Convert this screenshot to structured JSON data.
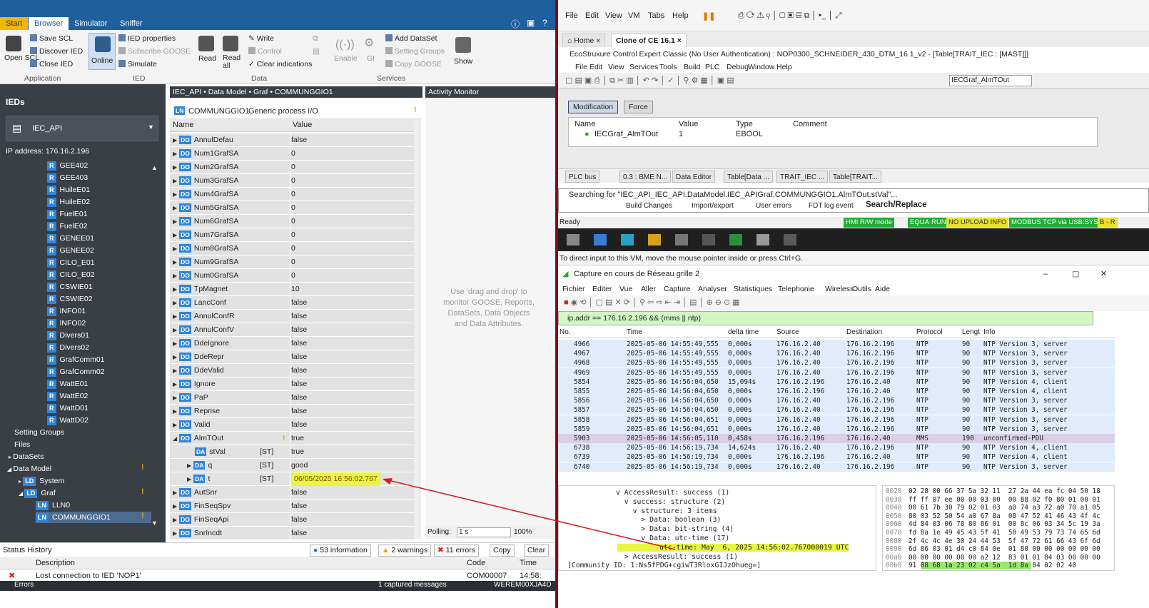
{
  "left_app": {
    "tabs": [
      "Start",
      "Browser",
      "Simulator",
      "Sniffer"
    ],
    "ribbon": {
      "open_scl": "Open SCL",
      "save_scl": "Save SCL",
      "discover_ied": "Discover IED",
      "close_ied": "Close IED",
      "online": "Online",
      "ied_properties": "IED properties",
      "subscribe_goose": "Subscribe GOOSE",
      "simulate": "Simulate",
      "read": "Read",
      "read_all": "Read all",
      "write": "Write",
      "control": "Control",
      "clear_indications": "Clear indications",
      "enable": "Enable",
      "gi": "GI",
      "add_dataset": "Add DataSet",
      "setting_groups": "Setting Groups",
      "copy_goose": "Copy GOOSE",
      "show": "Show",
      "groups": [
        "Application",
        "IED",
        "Data",
        "Services"
      ]
    },
    "sidebar": {
      "title": "IEDs",
      "ied_name": "IEC_API",
      "ip": "IP address: 176.16.2.196",
      "r_items": [
        "GEE402",
        "GEE403",
        "HuileE01",
        "HuileE02",
        "FuelE01",
        "FuelE02",
        "GENEE01",
        "GENEE02",
        "CILO_E01",
        "CILO_E02",
        "CSWIE01",
        "CSWIE02",
        "INFO01",
        "INFO02",
        "Divers01",
        "Divers02",
        "GrafComm01",
        "GrafComm02",
        "WattE01",
        "WattE02",
        "WattD01",
        "WattD02"
      ],
      "setting_groups": "Setting Groups",
      "files": "Files",
      "datasets": "DataSets",
      "data_model": "Data Model",
      "system": "System",
      "graf": "Graf",
      "lln0": "LLN0",
      "commun": "COMMUNGGIO1"
    },
    "center": {
      "breadcrumb": "IEC_API • Data Model • Graf • COMMUNGGIO1",
      "ln_name": "COMMUNGGIO1",
      "ln_desc": "Generic process I/O",
      "col_name": "Name",
      "col_value": "Value",
      "rows": [
        {
          "n": "AnnulDefau",
          "v": "false"
        },
        {
          "n": "Num1GrafSA",
          "v": "0"
        },
        {
          "n": "Num2GrafSA",
          "v": "0"
        },
        {
          "n": "Num3GrafSA",
          "v": "0"
        },
        {
          "n": "Num4GrafSA",
          "v": "0"
        },
        {
          "n": "Num5GrafSA",
          "v": "0"
        },
        {
          "n": "Num6GrafSA",
          "v": "0"
        },
        {
          "n": "Num7GrafSA",
          "v": "0"
        },
        {
          "n": "Num8GrafSA",
          "v": "0"
        },
        {
          "n": "Num9GrafSA",
          "v": "0"
        },
        {
          "n": "Num0GrafSA",
          "v": "0"
        },
        {
          "n": "TpMagnet",
          "v": "10"
        },
        {
          "n": "LancConf",
          "v": "false"
        },
        {
          "n": "AnnulConfR",
          "v": "false"
        },
        {
          "n": "AnnulConfV",
          "v": "false"
        },
        {
          "n": "DdeIgnore",
          "v": "false"
        },
        {
          "n": "DdeRepr",
          "v": "false"
        },
        {
          "n": "DdeValid",
          "v": "false"
        },
        {
          "n": "Ignore",
          "v": "false"
        },
        {
          "n": "PaP",
          "v": "false"
        },
        {
          "n": "Reprise",
          "v": "false"
        },
        {
          "n": "Valid",
          "v": "false"
        },
        {
          "n": "AlmTOut",
          "v": "true"
        },
        {
          "n": "stVal",
          "v": "true",
          "fc": "[ST]"
        },
        {
          "n": "q",
          "v": "good",
          "fc": "[ST]"
        },
        {
          "n": "t",
          "v": "06/05/2025 16:56:02.767",
          "fc": "[ST]"
        },
        {
          "n": "AutSnr",
          "v": "false"
        },
        {
          "n": "FinSeqSpv",
          "v": "false"
        },
        {
          "n": "FinSeqApi",
          "v": "false"
        },
        {
          "n": "SnrIncdt",
          "v": "false"
        }
      ]
    },
    "activity": {
      "title": "Activity Monitor",
      "hint": "Use 'drag and drop' to monitor GOOSE, Reports, DataSets, Data Objects and Data Attributes.",
      "polling_label": "Polling:",
      "polling_value": "1 s",
      "zoom": "100%"
    },
    "status": {
      "title": "Status History",
      "info": "53 information",
      "warnings": "2 warnings",
      "errors": "11 errors",
      "copy": "Copy",
      "clear": "Clear",
      "col_desc": "Description",
      "col_code": "Code",
      "col_time": "Time",
      "row_desc": "Lost connection to IED 'NOP1'",
      "row_code": "COM00007",
      "row_time": "14:58:",
      "foot_errors": "Errors",
      "foot_captured": "1 captured messages",
      "foot_host": "WEREM00XJA4D"
    }
  },
  "vm": {
    "menu": [
      "File",
      "Edit",
      "View",
      "VM",
      "Tabs",
      "Help"
    ],
    "tab_home": "Home",
    "tab_clone": "Clone of CE 16.1",
    "eco_title": "EcoStruxure Control Expert Classic (No User Authentication) : NOP0300_SCHNEIDER_430_DTM_16.1_v2 - [Table[TRAIT_IEC : [MAST]]]",
    "eco_menu": [
      "File",
      "Edit",
      "View",
      "Services",
      "Tools",
      "Build",
      "PLC",
      "Debug",
      "Window",
      "Help"
    ],
    "eco_combo": "IECGraf_AlmTOut",
    "mod_tabs": [
      "Modification",
      "Force"
    ],
    "grid_cols": [
      "Name",
      "Value",
      "Type",
      "Comment"
    ],
    "grid_row": {
      "name": "IECGraf_AlmTOut",
      "value": "1",
      "type": "EBOOL"
    },
    "eco_tabs": [
      "PLC bus",
      "0.3 : BME N...",
      "Data Editor",
      "Table[Data ...",
      "TRAIT_IEC ...",
      "Table[TRAIT..."
    ],
    "search_text": "Searching for \"IEC_API_IEC_API.DataModel.IEC_APIGraf.COMMUNGGIO1.AlmTOut.stVal\"...",
    "search_tabs": [
      "Build Changes",
      "Import/export",
      "User errors",
      "FDT log event",
      "Search/Replace"
    ],
    "ready": "Ready",
    "status_items": [
      {
        "t": "HMI R/W mode",
        "c": "#1fae3a"
      },
      {
        "t": "EQUAL",
        "c": "#1fae3a"
      },
      {
        "t": "RUN",
        "c": "#1fae3a"
      },
      {
        "t": "NO UPLOAD INFO",
        "c": "#e8e02a"
      },
      {
        "t": "MODBUS TCP via USB:SYS",
        "c": "#1fae3a"
      },
      {
        "t": "B - R",
        "c": "#e8e02a"
      }
    ],
    "hint": "To direct input to this VM, move the mouse pointer inside or press Ctrl+G."
  },
  "wireshark": {
    "title": "Capture en cours de Réseau grille 2",
    "menu": [
      "Fichier",
      "Editer",
      "Vue",
      "Aller",
      "Capture",
      "Analyser",
      "Statistiques",
      "Telephonie",
      "Wireless",
      "Outils",
      "Aide"
    ],
    "filter": "ip.addr == 176.16.2.196 && (mms || ntp)",
    "cols": [
      "No.",
      "Time",
      "delta time",
      "Source",
      "Destination",
      "Protocol",
      "Lengt",
      "Info"
    ],
    "packets": [
      [
        "4966",
        "2025-05-06 14:55:49,555",
        "0,000s",
        "176.16.2.40",
        "176.16.2.196",
        "NTP",
        "90",
        "NTP Version 3, server"
      ],
      [
        "4967",
        "2025-05-06 14:55:49,555",
        "0,000s",
        "176.16.2.40",
        "176.16.2.196",
        "NTP",
        "90",
        "NTP Version 3, server"
      ],
      [
        "4968",
        "2025-05-06 14:55:49,555",
        "0,000s",
        "176.16.2.40",
        "176.16.2.196",
        "NTP",
        "90",
        "NTP Version 3, server"
      ],
      [
        "4969",
        "2025-05-06 14:55:49,555",
        "0,000s",
        "176.16.2.40",
        "176.16.2.196",
        "NTP",
        "90",
        "NTP Version 3, server"
      ],
      [
        "5854",
        "2025-05-06 14:56:04,650",
        "15,094s",
        "176.16.2.196",
        "176.16.2.40",
        "NTP",
        "90",
        "NTP Version 4, client"
      ],
      [
        "5855",
        "2025-05-06 14:56:04,650",
        "0,000s",
        "176.16.2.196",
        "176.16.2.40",
        "NTP",
        "90",
        "NTP Version 4, client"
      ],
      [
        "5856",
        "2025-05-06 14:56:04,650",
        "0,000s",
        "176.16.2.40",
        "176.16.2.196",
        "NTP",
        "90",
        "NTP Version 3, server"
      ],
      [
        "5857",
        "2025-05-06 14:56:04,650",
        "0,000s",
        "176.16.2.40",
        "176.16.2.196",
        "NTP",
        "90",
        "NTP Version 3, server"
      ],
      [
        "5858",
        "2025-05-06 14:56:04,651",
        "0,000s",
        "176.16.2.40",
        "176.16.2.196",
        "NTP",
        "90",
        "NTP Version 3, server"
      ],
      [
        "5859",
        "2025-05-06 14:56:04,651",
        "0,000s",
        "176.16.2.40",
        "176.16.2.196",
        "NTP",
        "90",
        "NTP Version 3, server"
      ],
      [
        "5903",
        "2025-05-06 14:56:05,110",
        "0,458s",
        "176.16.2.196",
        "176.16.2.40",
        "MMS",
        "190",
        "unconfirmed-PDU"
      ],
      [
        "6738",
        "2025-05-06 14:56:19,734",
        "14,624s",
        "176.16.2.40",
        "176.16.2.196",
        "NTP",
        "90",
        "NTP Version 4, client"
      ],
      [
        "6739",
        "2025-05-06 14:56:19,734",
        "0,000s",
        "176.16.2.196",
        "176.16.2.40",
        "NTP",
        "90",
        "NTP Version 4, client"
      ],
      [
        "6740",
        "2025-05-06 14:56:19,734",
        "0,000s",
        "176.16.2.40",
        "176.16.2.196",
        "NTP",
        "90",
        "NTP Version 3, server"
      ]
    ],
    "details": [
      "v AccessResult: success (1)",
      "  v success: structure (2)",
      "    v structure: 3 items",
      "      > Data: boolean (3)",
      "      > Data: bit-string (4)",
      "      v Data: utc-time (17)",
      "          utc-time: May  6, 2025 14:56:02.767000019 UTC",
      "  > AccessResult: success (1)",
      "[Community ID: 1:Ns5fPDG+cgiwT3RloxGIJzOhueg=]"
    ],
    "hex": [
      [
        "0020",
        "02 28 00 66 37 5a 32 11  27 2a 44 ea fc 04 50 18"
      ],
      [
        "0030",
        "ff ff 07 ee 00 00 03 00  00 88 02 f0 80 01 00 01"
      ],
      [
        "0040",
        "00 61 7b 30 79 02 01 03  a0 74 a3 72 a0 70 a1 05"
      ],
      [
        "0050",
        "80 03 52 50 54 a0 67 8a  08 47 52 41 46 43 4f 4c"
      ],
      [
        "0060",
        "4d 84 03 06 78 80 86 01  00 8c 06 03 34 5c 19 3a"
      ],
      [
        "0070",
        "fd 8a 1e 49 45 43 5f 41  50 49 53 79 73 74 65 6d"
      ],
      [
        "0080",
        "2f 4c 4c 4e 30 24 44 53  5f 47 72 61 66 43 6f 6d"
      ],
      [
        "0090",
        "6d 86 03 01 d4 c0 84 0e  01 80 00 00 00 00 00 00"
      ],
      [
        "00a0",
        "00 00 00 00 00 00 a2 12  83 01 01 84 03 00 00 00"
      ],
      [
        "00b0",
        "91 08 68 1a 23 02 c4 5a  1d 8a 84 02 02 40"
      ]
    ]
  }
}
